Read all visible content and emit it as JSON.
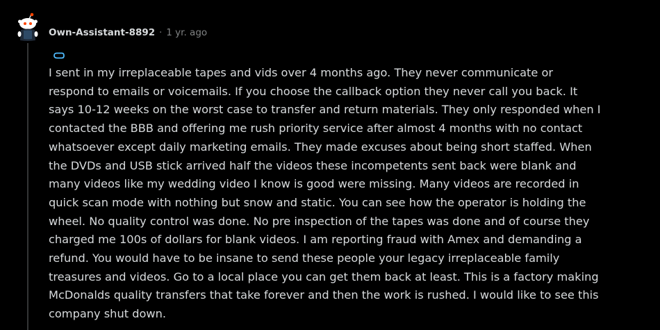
{
  "comment": {
    "author": "Own-Assistant-8892",
    "separator": "·",
    "age": "1 yr. ago",
    "body_lines": [
      "I sent in my irreplaceable tapes and vids over 4 months ago. They never communicate or",
      "respond to emails or voicemails. If you choose the callback option they never call you back. It",
      "says 10-12 weeks on the worst case to transfer and return materials. They only responded when I",
      "contacted the BBB and offering me rush priority service after almost 4 months with no contact",
      "whatsoever except daily marketing emails. They made excuses about being short staffed. When",
      "the DVDs and USB stick arrived half the videos these incompetents sent back were blank and",
      "many videos like my wedding video I know is good were missing. Many videos are recorded in",
      "quick scan mode with nothing but snow and static. You can see how the operator is holding the",
      "wheel. No quality control was done. No pre inspection of the tapes was done and of course they",
      "charged me 100s of dollars for blank videos. I am reporting fraud with Amex and demanding a",
      "refund. You would have to be insane to send these people your legacy irreplaceable family",
      "treasures and videos. Go to a local place you can get them back at least. This is a factory making",
      "McDonalds quality transfers that take forever and then the work is rushed. I would like to see this",
      "company shut down."
    ]
  },
  "icons": {
    "avatar": "snoo-avatar-icon",
    "flair": "flair-icon"
  },
  "colors": {
    "background": "#000000",
    "text": "#d7dadc",
    "meta": "#818384",
    "thread_line": "#343536",
    "avatar_accent": "#ff4500",
    "flair_accent": "#4fbcff"
  }
}
